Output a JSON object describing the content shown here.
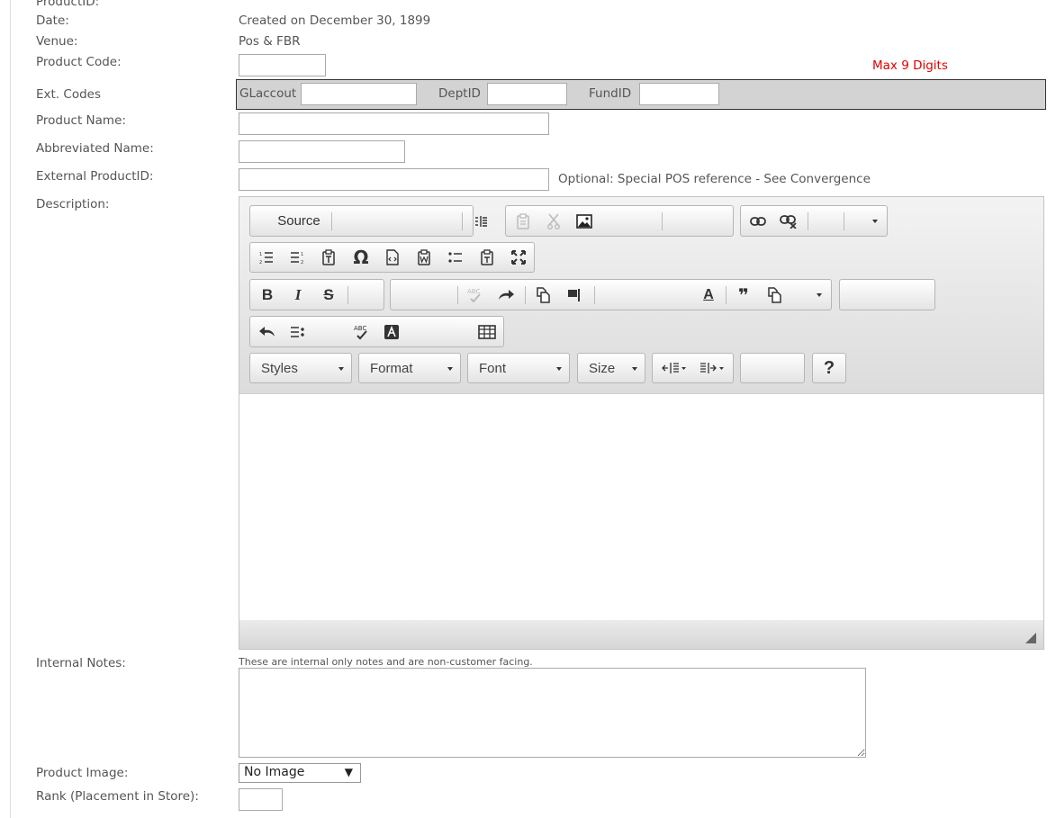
{
  "form": {
    "product_id_label": "ProductID:",
    "date_label": "Date:",
    "date_value": "Created on December 30, 1899",
    "venue_label": "Venue:",
    "venue_value": "Pos & FBR",
    "product_code_label": "Product Code:",
    "product_code_value": "",
    "product_code_hint": "Max 9 Digits",
    "ext_codes_label": "Ext. Codes",
    "glaccount_label": "GLaccout",
    "glaccount_value": "",
    "deptid_label": "DeptID",
    "deptid_value": "",
    "fundid_label": "FundID",
    "fundid_value": "",
    "product_name_label": "Product Name:",
    "product_name_value": "",
    "abbreviated_name_label": "Abbreviated Name:",
    "abbreviated_name_value": "",
    "external_productid_label": "External ProductID:",
    "external_productid_value": "",
    "external_productid_hint": "Optional: Special POS reference - See Convergence",
    "description_label": "Description:",
    "internal_notes_label": "Internal Notes:",
    "internal_notes_hint": "These are internal only notes and are non-customer facing.",
    "internal_notes_value": "",
    "product_image_label": "Product Image:",
    "product_image_selected": "No Image",
    "rank_label": "Rank (Placement in Store):",
    "rank_value": ""
  },
  "editor": {
    "source_label": "Source",
    "styles_label": "Styles",
    "format_label": "Format",
    "font_label": "Font",
    "size_label": "Size",
    "help_label": "?",
    "bold_label": "B",
    "italic_label": "I",
    "strike_label": "S",
    "omega_label": "Ω",
    "text_color_label": "A",
    "quote_label": "❞"
  },
  "colors": {
    "hint_red": "#d00000",
    "ext_codes_bg": "#d3d3d3"
  }
}
